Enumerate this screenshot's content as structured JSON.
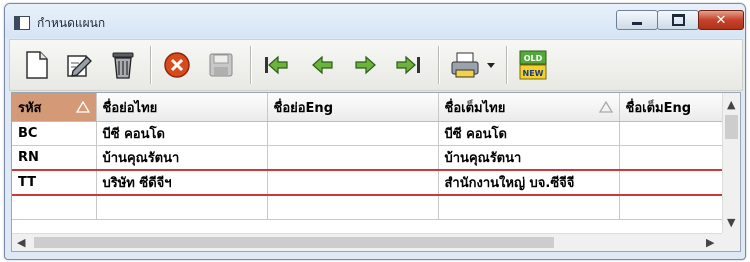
{
  "window": {
    "title": "กำหนดแผนก"
  },
  "toolbar": {
    "buttons": [
      {
        "icon": "new-document-icon"
      },
      {
        "icon": "edit-icon"
      },
      {
        "icon": "delete-trash-icon"
      },
      {
        "icon": "cancel-icon"
      },
      {
        "icon": "save-disk-icon",
        "disabled": true
      },
      {
        "icon": "first-record-icon"
      },
      {
        "icon": "previous-record-icon"
      },
      {
        "icon": "next-record-icon"
      },
      {
        "icon": "last-record-icon"
      },
      {
        "icon": "print-icon"
      },
      {
        "icon": "old-new-icon",
        "top_label": "OLD",
        "bottom_label": "NEW"
      }
    ]
  },
  "grid": {
    "columns": [
      "รหัส",
      "ชื่อย่อไทย",
      "ชื่อย่อEng",
      "ชื่อเต็มไทย",
      "ชื่อเต็มEng"
    ],
    "sorted_column": "รหัส",
    "rows": [
      [
        "BC",
        "บีซี คอนโด",
        "",
        "บีซี คอนโด",
        ""
      ],
      [
        "RN",
        "บ้านคุณรัตนา",
        "",
        "บ้านคุณรัตนา",
        ""
      ],
      [
        "TT",
        "บริษัท ซีดีจีฯ",
        "",
        "สำนักงานใหญ่ บจ.ซีจีจี",
        ""
      ]
    ],
    "selected_row": 2
  },
  "colors": {
    "sorted_header": "#d49a78",
    "selected_row_border": "#c93b3b",
    "window_bg": "#dfe9f5"
  }
}
